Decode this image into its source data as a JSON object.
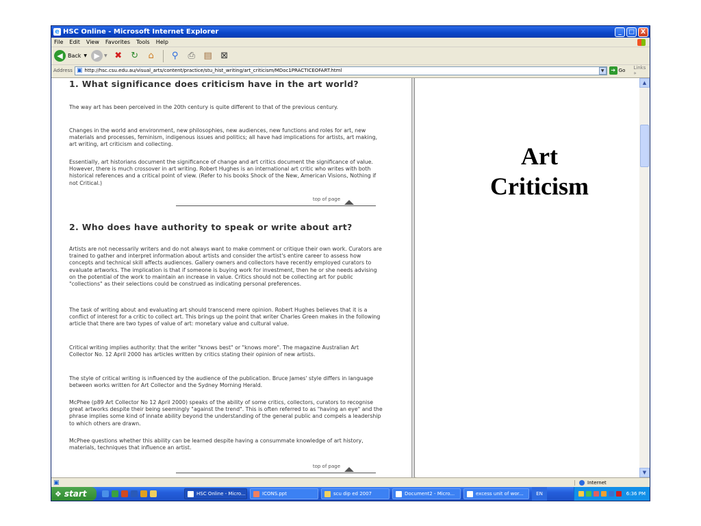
{
  "window": {
    "title": "HSC Online - Microsoft Internet Explorer",
    "controls": {
      "minimize": "_",
      "maximize": "□",
      "close": "X"
    }
  },
  "menu": [
    "File",
    "Edit",
    "View",
    "Favorites",
    "Tools",
    "Help"
  ],
  "toolbar": {
    "back_label": "Back"
  },
  "address": {
    "label": "Address",
    "url": "http://hsc.csu.edu.au/visual_arts/content/practice/stu_hist_writing/art_criticism/MDoc1PRACTICEOFART.html",
    "go_label": "Go",
    "links_label": "Links »"
  },
  "article": {
    "heading1": "1. What significance does criticism have in the art world?",
    "s1_p1": "The way art has been perceived in the 20th century is quite different to that of the previous century.",
    "s1_p2": "Changes in the world and environment, new philosophies, new audiences, new functions and roles for art, new materials and processes, feminism, indigenous issues and politics; all have had implications for artists, art making, art writing, art criticism and collecting.",
    "s1_p3": "Essentially, art historians document the significance of change and art critics document the significance of value. However, there is much crossover in art writing. Robert Hughes is an international art critic who writes with both historical references and a critical point of view. (Refer to his books Shock of the New, American Visions, Nothing if not Critical.)",
    "top_of_page": "top of page",
    "heading2": "2. Who does have authority to speak or write about art?",
    "s2_p1": "Artists are not necessarily writers and do not always want to make comment or critique their own work. Curators are trained to gather and interpret information about artists and consider the artist's entire career to assess how concepts and technical skill affects audiences. Gallery owners and collectors have recently employed curators to evaluate artworks. The implication is that if someone is buying work for investment, then he or she needs advising on the potential of the work to maintain an increase in value. Critics should not be collecting art for public \"collections\" as their selections could be construed as indicating personal preferences.",
    "s2_p2": "The task of writing about and evaluating art should transcend mere opinion. Robert Hughes believes that it is a conflict of interest for a critic to collect art. This brings up the point that writer Charles Green makes in the following article that there are two types of value of art: monetary value and cultural value.",
    "s2_p3": "Critical writing implies authority: that the writer \"knows best\" or \"knows more\". The magazine Australian Art Collector No. 12 April 2000 has articles written by critics stating their opinion of new artists.",
    "s2_p4": "The style of critical writing is influenced by the audience of the publication. Bruce James' style differs in language between works written for Art Collector and the Sydney Morning Herald.",
    "s2_p5": "McPhee (p89 Art Collector No 12 April 2000) speaks of the ability of some critics, collectors, curators to recognise great artworks despite their being seemingly \"against the trend\". This is often referred to as \"having an eye\" and the phrase implies some kind of innate ability beyond the understanding of the general public and compels a leadership to which others are drawn.",
    "s2_p6": "McPhee questions whether this ability can be learned despite having a consummate knowledge of art history, materials, techniques that influence an artist."
  },
  "slide": {
    "title_line1": "Art",
    "title_line2": "Criticism"
  },
  "status": {
    "zone": "Internet"
  },
  "taskbar": {
    "start": "start",
    "tasks": [
      "HSC Online - Micro...",
      "ICONS.ppt",
      "scu dip ed 2007",
      "Document2 - Micro...",
      "excess unit of wor..."
    ],
    "lang": "EN",
    "clock": "6:36 PM"
  }
}
